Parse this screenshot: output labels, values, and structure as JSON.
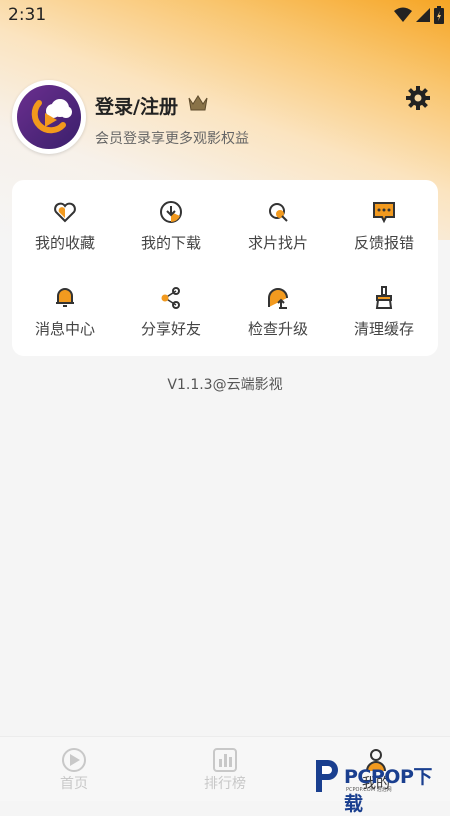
{
  "status_bar": {
    "time": "2:31"
  },
  "profile": {
    "login_label": "登录/注册",
    "subtitle": "会员登录享更多观影权益"
  },
  "menu": {
    "items": [
      {
        "label": "我的收藏",
        "icon": "heart-icon"
      },
      {
        "label": "我的下载",
        "icon": "download-icon"
      },
      {
        "label": "求片找片",
        "icon": "search-film-icon"
      },
      {
        "label": "反馈报错",
        "icon": "feedback-icon"
      },
      {
        "label": "消息中心",
        "icon": "bell-icon"
      },
      {
        "label": "分享好友",
        "icon": "share-icon"
      },
      {
        "label": "检查升级",
        "icon": "upgrade-icon"
      },
      {
        "label": "清理缓存",
        "icon": "broom-icon"
      }
    ]
  },
  "version": "V1.1.3@云端影视",
  "tabbar": {
    "tabs": [
      {
        "label": "首页",
        "icon": "home-icon"
      },
      {
        "label": "排行榜",
        "icon": "ranking-icon"
      },
      {
        "label": "我的",
        "icon": "user-icon"
      }
    ]
  },
  "watermark": {
    "text": "PCPOP下载",
    "sub": "PCPOP.COM 泡泡网"
  },
  "colors": {
    "accent": "#f29a1f",
    "brand": "#5a2a86"
  }
}
